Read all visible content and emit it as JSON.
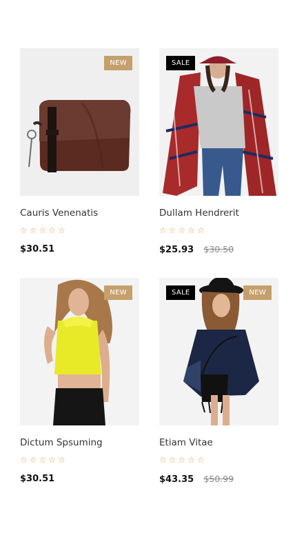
{
  "products": [
    {
      "title": "Cauris Venenatis",
      "badges": [
        "NEW"
      ],
      "price": "$30.51",
      "old_price": "",
      "rating": "0 of 5"
    },
    {
      "title": "Dullam Hendrerit",
      "badges": [
        "SALE"
      ],
      "price": "$25.93",
      "old_price": "$30.50",
      "rating": "0 of 5"
    },
    {
      "title": "Dictum Spsuming",
      "badges": [
        "NEW"
      ],
      "price": "$30.51",
      "old_price": "",
      "rating": "0 of 5"
    },
    {
      "title": "Etiam Vitae",
      "badges": [
        "SALE",
        "NEW"
      ],
      "price": "$43.35",
      "old_price": "$50.99",
      "rating": "0 of 5"
    }
  ],
  "colors": {
    "new_badge": "#c5a06c",
    "sale_badge": "#000000",
    "star": "#e09b4d"
  },
  "icons": {
    "star": "star-outline-icon"
  }
}
